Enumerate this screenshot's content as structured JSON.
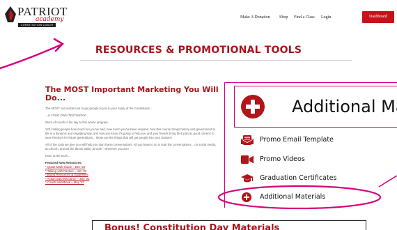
{
  "header": {
    "logo": {
      "brand": "PATRIOT",
      "script": "academy",
      "tag": "CONSTITUTION COACH"
    },
    "nav": [
      {
        "label": "Make A Donation"
      },
      {
        "label": "Shop"
      },
      {
        "label": "Find a Class"
      },
      {
        "label": "Login"
      }
    ],
    "dashboard_label": "Dashboard"
  },
  "page_title": "RESOURCES & PROMOTIONAL TOOLS",
  "article": {
    "title": "The MOST Important Marketing You Will Do...",
    "paragraphs": [
      "The MOST successful tool to get people to join in your study of the Constitution...",
      "...is YOUR OWN TESTIMONY!",
      "Word of mouth is the key to this whole program.",
      "YOU telling people how much fun you've had, how much you've been inspired, how this course brings history and government to life in a dynamic and engaging way, and how you know it's going to help you and your friends bring their part as good citizens to save freedom for future generations... those are the things that will get people into your classes!",
      "All of the tools we give you will help you start these conversations. All you have to do is start the conversations... on social media, at Church, around the dinner table, at work - wherever you are!",
      "Now, to the tools..."
    ],
    "featured_heading": "Featured New Resources:",
    "featured_links": [
      "* Quote Math Guide – Dec '22",
      "* Talking with Pastors – Jan '23",
      "* Brand Resources & Guidelines",
      "* Action Step Resource – July '23",
      "* Coach Handbook – May '23"
    ]
  },
  "callout": {
    "heading": "Additional Materials",
    "items": [
      {
        "label": "Promo Email Template",
        "icon": "email-icon"
      },
      {
        "label": "Promo Videos",
        "icon": "video-camera-icon"
      },
      {
        "label": "Graduation Certificates",
        "icon": "graduation-cap-icon"
      },
      {
        "label": "Additional Materials",
        "icon": "plus-circle-icon"
      }
    ]
  },
  "bottom_heading": "Bonus! Constitution Day Materials",
  "colors": {
    "brand_red": "#a7141c",
    "button_red": "#c8121a",
    "annotation_magenta": "#d6007e"
  }
}
